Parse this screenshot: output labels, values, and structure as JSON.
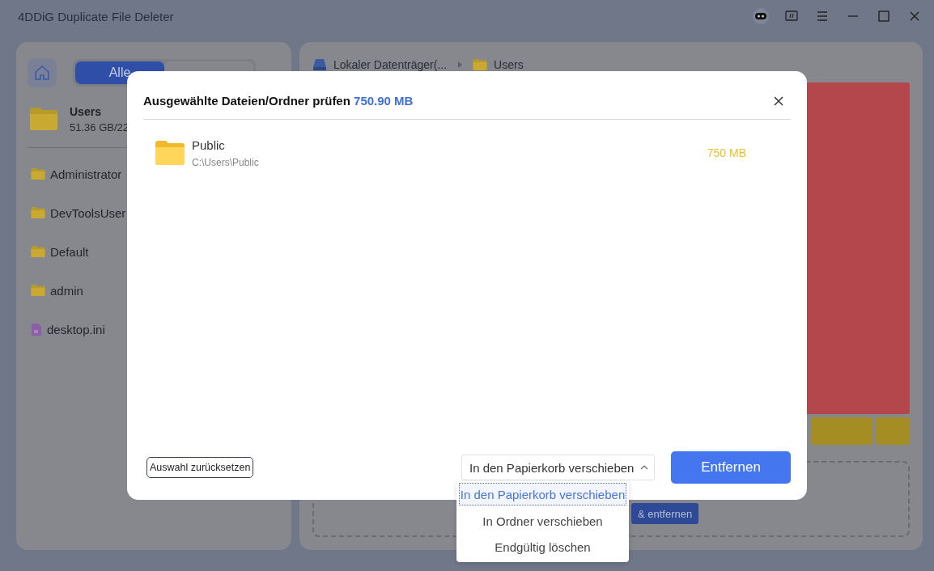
{
  "window": {
    "title": "4DDiG Duplicate File Deleter"
  },
  "sidebar": {
    "tabs": [
      {
        "label": "Alle",
        "selected": true
      },
      {
        "selected": false
      }
    ],
    "current": {
      "name": "Users",
      "size": "51.36 GB/22"
    },
    "items": [
      {
        "name": "Administrator",
        "kind": "folder"
      },
      {
        "name": "DevToolsUser",
        "kind": "folder"
      },
      {
        "name": "Default",
        "kind": "folder"
      },
      {
        "name": "admin",
        "kind": "folder"
      },
      {
        "name": "desktop.ini",
        "kind": "file"
      }
    ]
  },
  "breadcrumb": [
    {
      "label": "Lokaler Datenträger(...",
      "kind": "drive"
    },
    {
      "label": "Users",
      "kind": "folder"
    }
  ],
  "preview": {
    "action_label": "& entfernen"
  },
  "dialog": {
    "title": "Ausgewählte Dateien/Ordner prüfen",
    "total": "750.90 MB",
    "files": [
      {
        "name": "Public",
        "path": "C:\\Users\\Public",
        "size": "750 MB"
      }
    ],
    "reset_button": "Auswahl zurücksetzen",
    "action_select": {
      "value": "In den Papierkorb verschieben",
      "expanded": true,
      "options": [
        {
          "label": "In den Papierkorb verschieben",
          "selected": true
        },
        {
          "label": "In Ordner verschieben",
          "selected": false
        },
        {
          "label": "Endgültig löschen",
          "selected": false
        }
      ]
    },
    "confirm_button": "Entfernen"
  }
}
